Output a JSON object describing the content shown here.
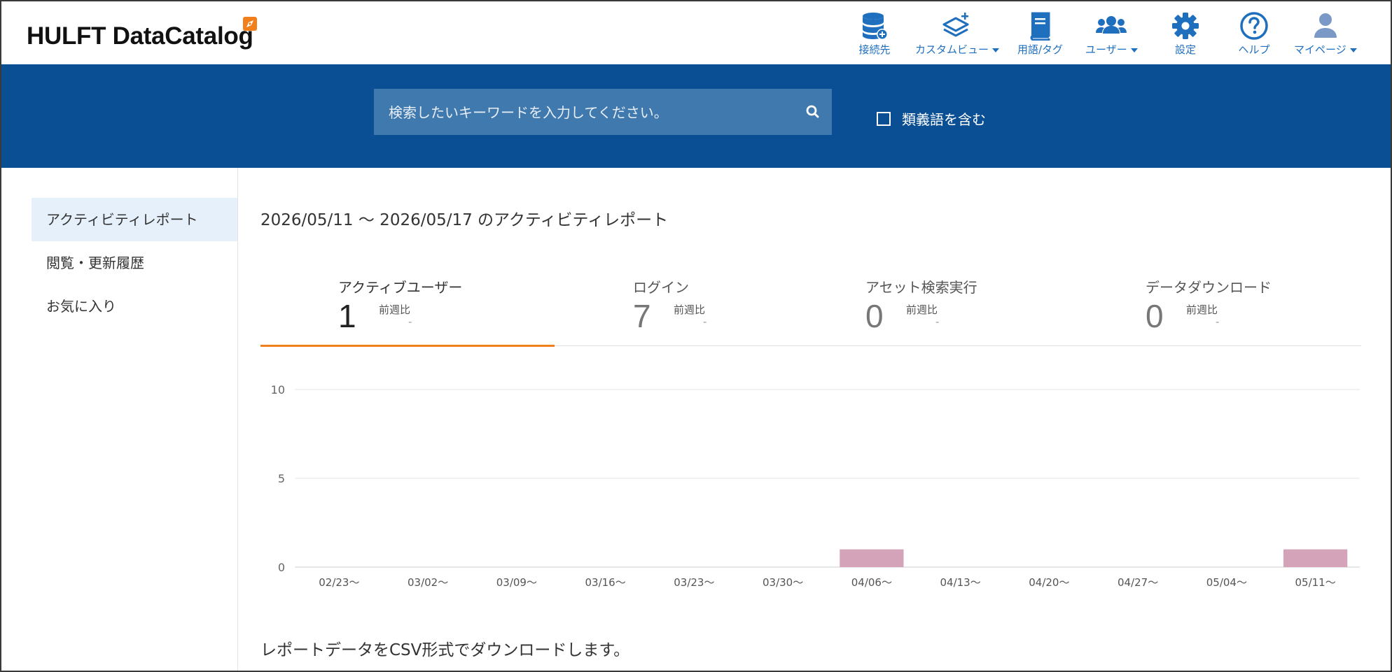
{
  "app": {
    "logo_text": "HULFT DataCatalog"
  },
  "header": {
    "nav": [
      {
        "label": "接続先",
        "icon": "database-plus-icon",
        "dropdown": false
      },
      {
        "label": "カスタムビュー",
        "icon": "layers-plus-icon",
        "dropdown": true
      },
      {
        "label": "用語/タグ",
        "icon": "book-icon",
        "dropdown": false
      },
      {
        "label": "ユーザー",
        "icon": "users-icon",
        "dropdown": true
      },
      {
        "label": "設定",
        "icon": "gear-icon",
        "dropdown": false
      },
      {
        "label": "ヘルプ",
        "icon": "help-circle-icon",
        "dropdown": false
      },
      {
        "label": "マイページ",
        "icon": "user-icon",
        "dropdown": true
      }
    ],
    "accent_color": "#1f6fbf"
  },
  "search": {
    "placeholder": "検索したいキーワードを入力してください。",
    "value": "",
    "synonym_label": "類義語を含む",
    "synonym_checked": false,
    "band_color": "#0a4f94"
  },
  "sidebar": {
    "items": [
      {
        "label": "アクティビティレポート",
        "active": true
      },
      {
        "label": "閲覧・更新履歴",
        "active": false
      },
      {
        "label": "お気に入り",
        "active": false
      }
    ]
  },
  "report": {
    "title": "2026/05/11 ～ 2026/05/17 のアクティビティレポート",
    "tabs": [
      {
        "label": "アクティブユーザー",
        "value": "1",
        "compare_label": "前週比",
        "compare_value": "-",
        "active": true
      },
      {
        "label": "ログイン",
        "value": "7",
        "compare_label": "前週比",
        "compare_value": "-",
        "active": false
      },
      {
        "label": "アセット検索実行",
        "value": "0",
        "compare_label": "前週比",
        "compare_value": "-",
        "active": false
      },
      {
        "label": "データダウンロード",
        "value": "0",
        "compare_label": "前週比",
        "compare_value": "-",
        "active": false
      }
    ],
    "csv_text": "レポートデータをCSV形式でダウンロードします。"
  },
  "chart_data": {
    "type": "bar",
    "categories": [
      "02/23～",
      "03/02～",
      "03/09～",
      "03/16～",
      "03/23～",
      "03/30～",
      "04/06～",
      "04/13～",
      "04/20～",
      "04/27～",
      "05/04～",
      "05/11～"
    ],
    "values": [
      0,
      0,
      0,
      0,
      0,
      0,
      1,
      0,
      0,
      0,
      0,
      1
    ],
    "ylim": [
      0,
      10
    ],
    "yticks": [
      0,
      5,
      10
    ],
    "grid": true,
    "bar_color": "#d5a3b9"
  }
}
